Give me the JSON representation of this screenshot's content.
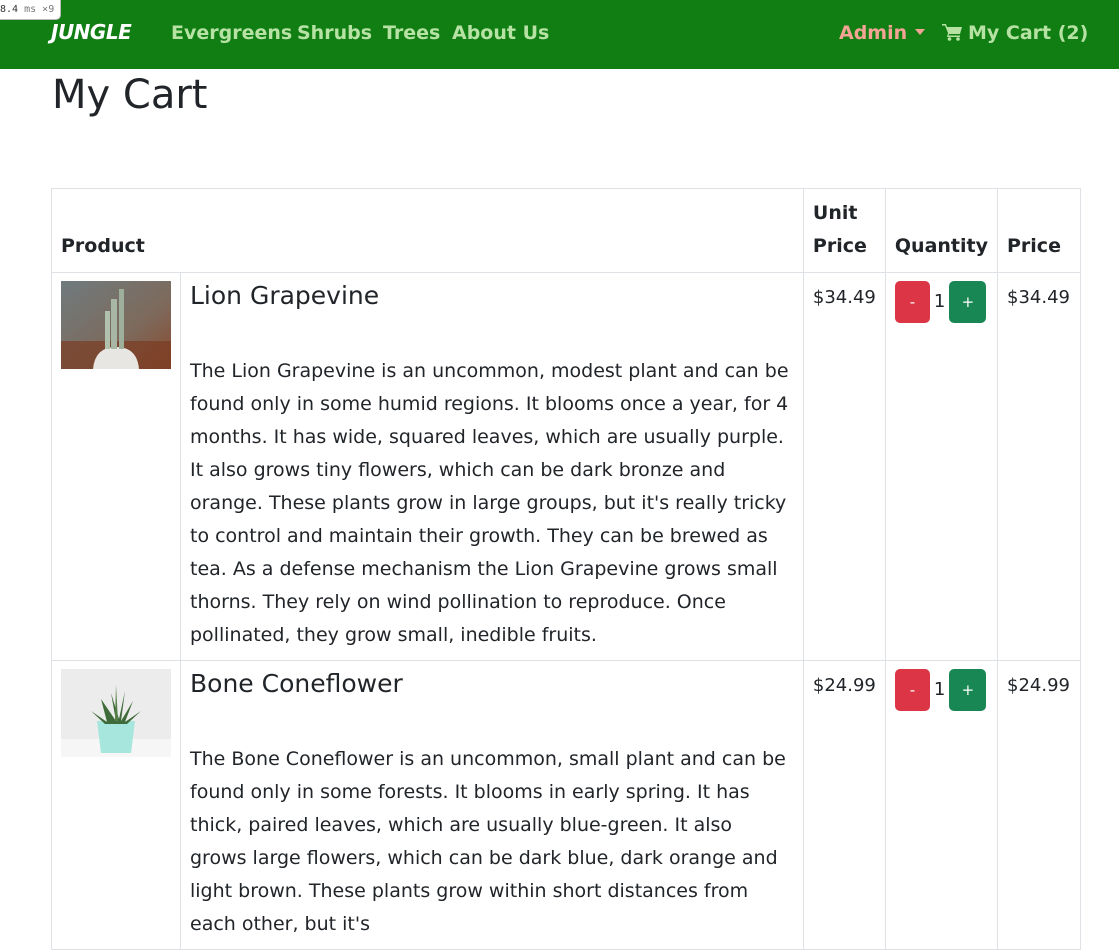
{
  "overlay": {
    "perf": "8.4",
    "perf_unit": "ms",
    "perf_count": "×9"
  },
  "nav": {
    "brand": "JUNGLE",
    "links": [
      "Evergreens",
      "Shrubs",
      "Trees",
      "About Us"
    ],
    "admin": "Admin",
    "cart": "My Cart (2)",
    "colors": {
      "bar": "#117e13",
      "link": "#b6e2a4",
      "admin": "#f4a494"
    }
  },
  "page": {
    "title": "My Cart"
  },
  "table": {
    "headers": {
      "product": "Product",
      "unit_price": "Unit Price",
      "quantity": "Quantity",
      "price": "Price"
    },
    "rows": [
      {
        "name": "Lion Grapevine",
        "description": "The Lion Grapevine is an uncommon, modest plant and can be found only in some humid regions. It blooms once a year, for 4 months. It has wide, squared leaves, which are usually purple. It also grows tiny flowers, which can be dark bronze and orange. These plants grow in large groups, but it's really tricky to control and maintain their growth. They can be brewed as tea. As a defense mechanism the Lion Grapevine grows small thorns. They rely on wind pollination to reproduce. Once pollinated, they grow small, inedible fruits.",
        "unit_price": "$34.49",
        "quantity": "1",
        "price": "$34.49",
        "minus": "-",
        "plus": "+"
      },
      {
        "name": "Bone Coneflower",
        "description": "The Bone Coneflower is an uncommon, small plant and can be found only in some forests. It blooms in early spring. It has thick, paired leaves, which are usually blue-green. It also grows large flowers, which can be dark blue, dark orange and light brown. These plants grow within short distances from each other, but it's",
        "unit_price": "$24.99",
        "quantity": "1",
        "price": "$24.99",
        "minus": "-",
        "plus": "+"
      }
    ]
  }
}
